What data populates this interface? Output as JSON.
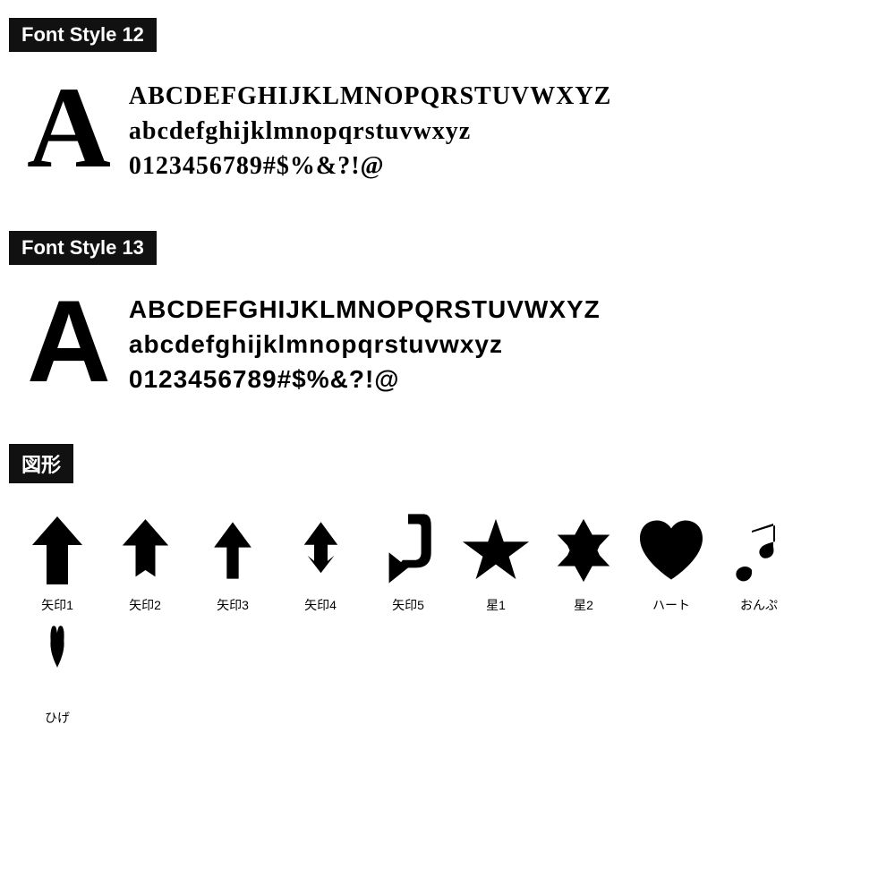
{
  "font12": {
    "label": "Font Style 12",
    "bigLetter": "A",
    "lines": [
      "ABCDEFGHIJKLMNOPQRSTUVWXYZ",
      "abcdefghijklmnopqrstuvwxyz",
      "0123456789#$%&?!@"
    ]
  },
  "font13": {
    "label": "Font Style 13",
    "bigLetter": "A",
    "lines": [
      "ABCDEFGHIJKLMNOPQRSTUVWXYZ",
      "abcdefghijklmnopqrstuvwxyz",
      "0123456789#$%&?!@"
    ]
  },
  "shapes": {
    "label": "図形",
    "items": [
      {
        "name": "矢印1"
      },
      {
        "name": "矢印2"
      },
      {
        "name": "矢印3"
      },
      {
        "name": "矢印4"
      },
      {
        "name": "矢印5"
      },
      {
        "name": "星1"
      },
      {
        "name": "星2"
      },
      {
        "name": "ハート"
      },
      {
        "name": "おんぷ"
      },
      {
        "name": "ひげ"
      }
    ]
  }
}
